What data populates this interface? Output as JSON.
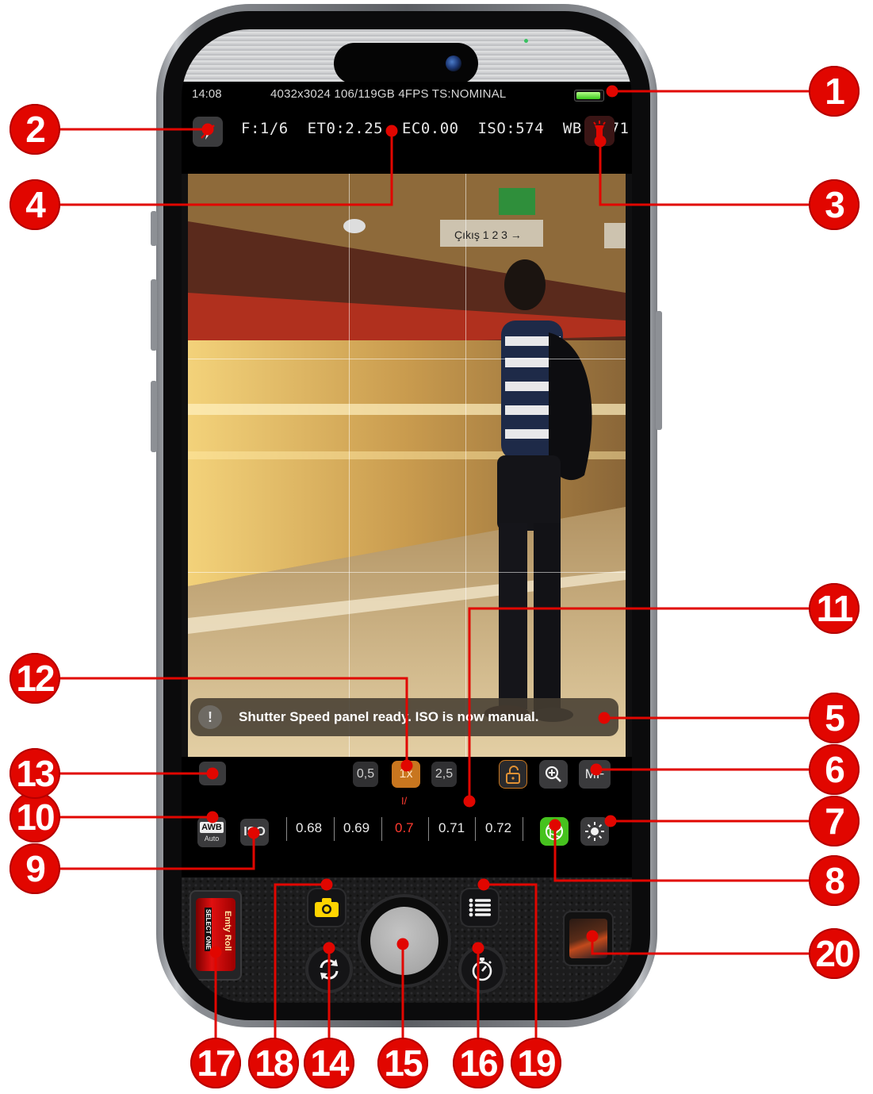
{
  "status_bar": {
    "time": "14:08",
    "info": "4032x3024 106/119GB  4FPS TS:NOMINAL"
  },
  "camera_params": {
    "text": "F:1/6  ET0:2.25  EC0.00  ISO:574  WB:5971"
  },
  "notice": {
    "icon": "!",
    "message": "Shutter Speed panel ready. ISO is now manual."
  },
  "controls": {
    "program_mode": "P",
    "zoom_options": [
      "0,5",
      "1x",
      "2,5"
    ],
    "zoom_selected": "1x",
    "manual_focus": "MF",
    "awb_label": "AWB",
    "awb_sub": "Auto",
    "iso_label": "ISO",
    "scale_values": [
      "0.68",
      "0.69",
      "0.7",
      "0.71",
      "0.72"
    ],
    "scale_selected": "0.7",
    "scale_indicator": "I/"
  },
  "film_roll": {
    "title": "Emty Roll",
    "subtitle": "SELECT ONE"
  },
  "callouts": [
    "1",
    "2",
    "3",
    "4",
    "5",
    "6",
    "7",
    "8",
    "9",
    "10",
    "11",
    "12",
    "13",
    "14",
    "15",
    "16",
    "17",
    "18",
    "19",
    "20"
  ],
  "icons": {
    "flash": "flash-off-icon",
    "torch": "torch-icon",
    "lock": "unlock-icon",
    "zoom_in": "magnifier-plus-icon",
    "exposure": "sun-icon",
    "aperture": "aperture-icon",
    "capture_mode": "camera-icon",
    "flip": "rotate-camera-icon",
    "timer": "stopwatch-icon",
    "menu": "list-icon"
  },
  "colors": {
    "callout_red": "#e10600",
    "accent_orange": "#c8761f",
    "accent_green": "#46c21e",
    "selected_scale_red": "#ff3b30"
  }
}
